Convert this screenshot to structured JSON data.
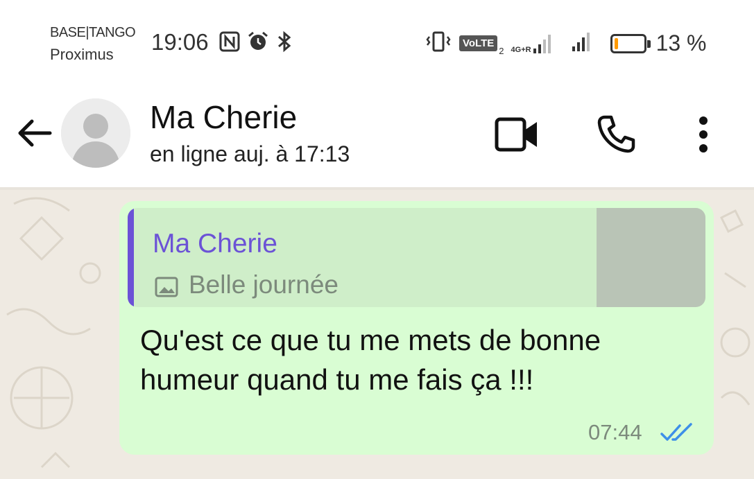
{
  "status_bar": {
    "carrier_main": "BASE|TANGO",
    "carrier_sub": "Proximus",
    "time": "19:06",
    "left_icons": [
      "nfc-icon",
      "alarm-icon",
      "bluetooth-icon"
    ],
    "right_icons": [
      "vibrate-icon",
      "volte-badge",
      "signal-icon",
      "signal-icon"
    ],
    "volte_label": "VoLTE",
    "volte_sim": "2",
    "network_type": "4G+R",
    "battery_percent": "13 %",
    "battery_level": 0.13,
    "battery_color": "#ff9a00"
  },
  "header": {
    "contact_name": "Ma Cherie",
    "last_seen": "en ligne auj. à 17:13",
    "actions": [
      "back-arrow-icon",
      "video-call-icon",
      "voice-call-icon",
      "more-options-icon"
    ]
  },
  "message": {
    "quote": {
      "author": "Ma Cherie",
      "text": "Belle journée",
      "icon": "image-icon",
      "accent_color": "#6b52d6"
    },
    "text": "Qu'est ce que tu me mets de bonne humeur quand tu me fais ça !!!",
    "time": "07:44",
    "status_icon": "double-check-icon",
    "status_color": "#3d8fe8",
    "bubble_color": "#d9fdd3"
  }
}
